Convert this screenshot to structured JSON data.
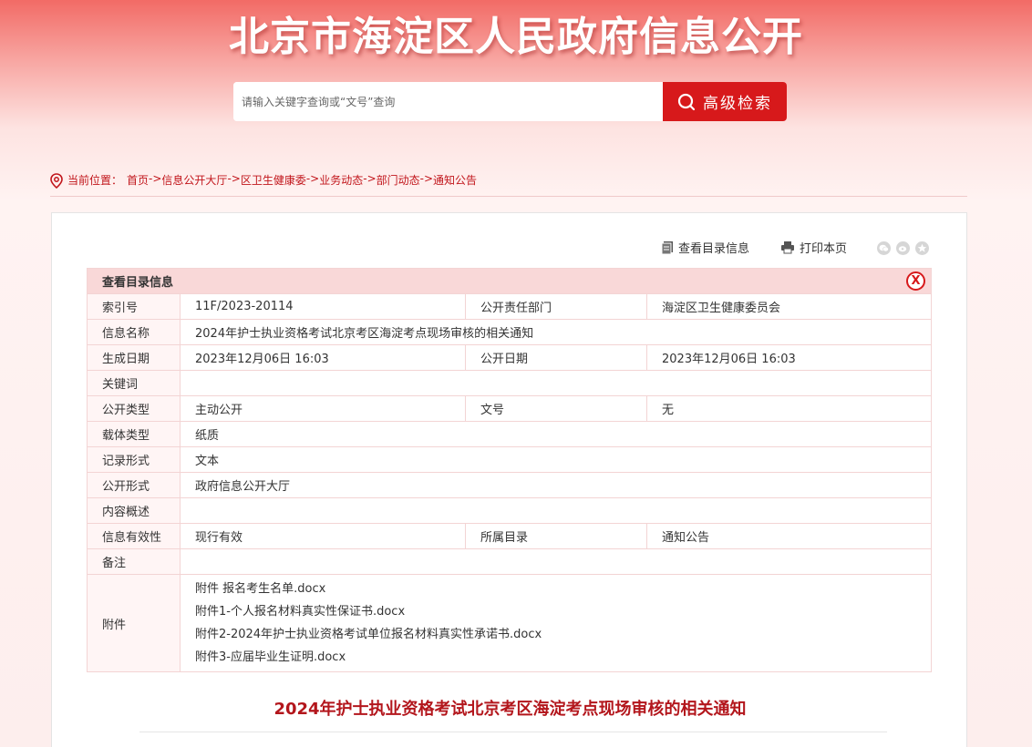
{
  "header": {
    "title": "北京市海淀区人民政府信息公开"
  },
  "search": {
    "placeholder": "请输入关键字查询或“文号”查询",
    "button_label": "高级检索"
  },
  "breadcrumb": {
    "prefix": "当前位置：",
    "items": [
      "首页",
      "信息公开大厅",
      "区卫生健康委",
      "业务动态",
      "部门动态",
      "通知公告"
    ],
    "separator": "->"
  },
  "toolbar": {
    "catalog_label": "查看目录信息",
    "print_label": "打印本页"
  },
  "catalog": {
    "heading": "查看目录信息",
    "close_label": "X",
    "rows": [
      {
        "label": "索引号",
        "value": "11F/2023-20114",
        "label2": "公开责任部门",
        "value2": "海淀区卫生健康委员会"
      },
      {
        "label": "信息名称",
        "value": "2024年护士执业资格考试北京考区海淀考点现场审核的相关通知"
      },
      {
        "label": "生成日期",
        "value": "2023年12月06日 16:03",
        "label2": "公开日期",
        "value2": "2023年12月06日 16:03"
      },
      {
        "label": "关键词",
        "value": ""
      },
      {
        "label": "公开类型",
        "value": "主动公开",
        "label2": "文号",
        "value2": "无"
      },
      {
        "label": "载体类型",
        "value": "纸质"
      },
      {
        "label": "记录形式",
        "value": "文本"
      },
      {
        "label": "公开形式",
        "value": "政府信息公开大厅"
      },
      {
        "label": "内容概述",
        "value": ""
      },
      {
        "label": "信息有效性",
        "value": "现行有效",
        "label2": "所属目录",
        "value2": "通知公告"
      },
      {
        "label": "备注",
        "value": ""
      }
    ],
    "attachments_label": "附件",
    "attachments": [
      "附件 报名考生名单.docx",
      "附件1-个人报名材料真实性保证书.docx",
      "附件2-2024年护士执业资格考试单位报名材料真实性承诺书.docx",
      "附件3-应届毕业生证明.docx"
    ]
  },
  "document": {
    "title": "2024年护士执业资格考试北京考区海淀考点现场审核的相关通知"
  },
  "colors": {
    "accent": "#d7191b",
    "link": "#c1151b",
    "title": "#b3161c"
  }
}
